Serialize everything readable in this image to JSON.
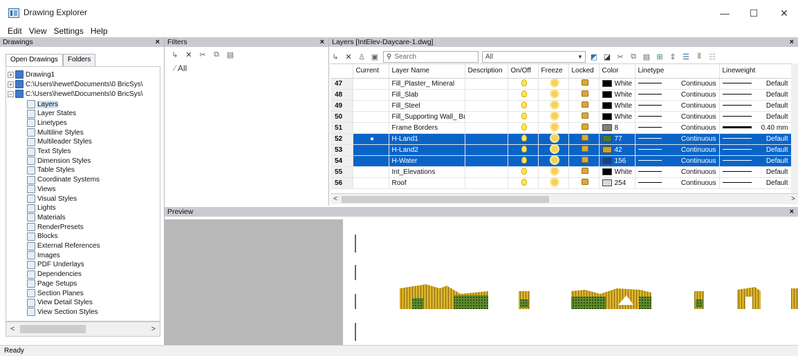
{
  "window": {
    "title": "Drawing Explorer",
    "minimize": "—",
    "maximize": "☐",
    "close": "✕"
  },
  "menu": [
    "Edit",
    "View",
    "Settings",
    "Help"
  ],
  "drawings_panel": {
    "title": "Drawings",
    "close": "×",
    "tabs": [
      "Open Drawings",
      "Folders"
    ],
    "drawings": [
      "Drawing1",
      "C:\\Users\\hewet\\Documents\\0 BricSys\\",
      "C:\\Users\\hewet\\Documents\\0 BricSys\\"
    ],
    "items": [
      {
        "label": "Layers",
        "icon": "layers-icon"
      },
      {
        "label": "Layer States",
        "icon": "layer-states-icon"
      },
      {
        "label": "Linetypes",
        "icon": "linetypes-icon"
      },
      {
        "label": "Multiline Styles",
        "icon": "multiline-styles-icon"
      },
      {
        "label": "Multileader Styles",
        "icon": "multileader-styles-icon"
      },
      {
        "label": "Text Styles",
        "icon": "text-styles-icon"
      },
      {
        "label": "Dimension Styles",
        "icon": "dimension-styles-icon"
      },
      {
        "label": "Table Styles",
        "icon": "table-styles-icon"
      },
      {
        "label": "Coordinate Systems",
        "icon": "coordinate-systems-icon"
      },
      {
        "label": "Views",
        "icon": "views-icon"
      },
      {
        "label": "Visual Styles",
        "icon": "visual-styles-icon"
      },
      {
        "label": "Lights",
        "icon": "lights-icon"
      },
      {
        "label": "Materials",
        "icon": "materials-icon"
      },
      {
        "label": "RenderPresets",
        "icon": "render-presets-icon"
      },
      {
        "label": "Blocks",
        "icon": "blocks-icon"
      },
      {
        "label": "External References",
        "icon": "external-references-icon"
      },
      {
        "label": "Images",
        "icon": "images-icon"
      },
      {
        "label": "PDF Underlays",
        "icon": "pdf-underlays-icon"
      },
      {
        "label": "Dependencies",
        "icon": "dependencies-icon"
      },
      {
        "label": "Page Setups",
        "icon": "page-setups-icon"
      },
      {
        "label": "Section Planes",
        "icon": "section-planes-icon"
      },
      {
        "label": "View Detail Styles",
        "icon": "view-detail-styles-icon"
      },
      {
        "label": "View Section Styles",
        "icon": "view-section-styles-icon"
      }
    ],
    "scroll_left": "<",
    "scroll_right": ">"
  },
  "filters_panel": {
    "title": "Filters",
    "close": "×",
    "root": "All"
  },
  "layers_panel": {
    "title": "Layers [IntElev-Daycare-1.dwg]",
    "close": "×",
    "search_placeholder": "Search",
    "filter_value": "All",
    "columns": [
      "",
      "Current",
      "Layer Name",
      "Description",
      "On/Off",
      "Freeze",
      "Locked",
      "Color",
      "Linetype",
      "Lineweight"
    ],
    "rows": [
      {
        "n": "47",
        "current": "",
        "name": "Fill_Plaster_ Mineral",
        "color": "White",
        "color_hex": "#000000",
        "linetype": "Continuous",
        "lineweight": "Default",
        "selected": false
      },
      {
        "n": "48",
        "current": "",
        "name": "Fill_Slab",
        "color": "White",
        "color_hex": "#000000",
        "linetype": "Continuous",
        "lineweight": "Default",
        "selected": false
      },
      {
        "n": "49",
        "current": "",
        "name": "Fill_Steel",
        "color": "White",
        "color_hex": "#000000",
        "linetype": "Continuous",
        "lineweight": "Default",
        "selected": false
      },
      {
        "n": "50",
        "current": "",
        "name": "Fill_Supporting Wall_ Brick",
        "color": "White",
        "color_hex": "#000000",
        "linetype": "Continuous",
        "lineweight": "Default",
        "selected": false
      },
      {
        "n": "51",
        "current": "",
        "name": "Frame Borders",
        "color": "8",
        "color_hex": "#808080",
        "linetype": "Continuous",
        "lineweight": "0.40 mm",
        "selected": false
      },
      {
        "n": "52",
        "current": "●",
        "name": "H-Land1",
        "color": "77",
        "color_hex": "#4f7a2a",
        "linetype": "Continuous",
        "lineweight": "Default",
        "selected": true
      },
      {
        "n": "53",
        "current": "",
        "name": "H-Land2",
        "color": "42",
        "color_hex": "#c9a227",
        "linetype": "Continuous",
        "lineweight": "Default",
        "selected": true
      },
      {
        "n": "54",
        "current": "",
        "name": "H-Water",
        "color": "156",
        "color_hex": "#1f3f86",
        "linetype": "Continuous",
        "lineweight": "Default",
        "selected": true
      },
      {
        "n": "55",
        "current": "",
        "name": "Int_Elevations",
        "color": "White",
        "color_hex": "#000000",
        "linetype": "Continuous",
        "lineweight": "Default",
        "selected": false
      },
      {
        "n": "56",
        "current": "",
        "name": "Roof",
        "color": "254",
        "color_hex": "#d9d9d9",
        "linetype": "Continuous",
        "lineweight": "Default",
        "selected": false
      }
    ],
    "scroll_left": "<",
    "scroll_right": ">"
  },
  "preview_panel": {
    "title": "Preview",
    "close": "×"
  },
  "status": "Ready"
}
